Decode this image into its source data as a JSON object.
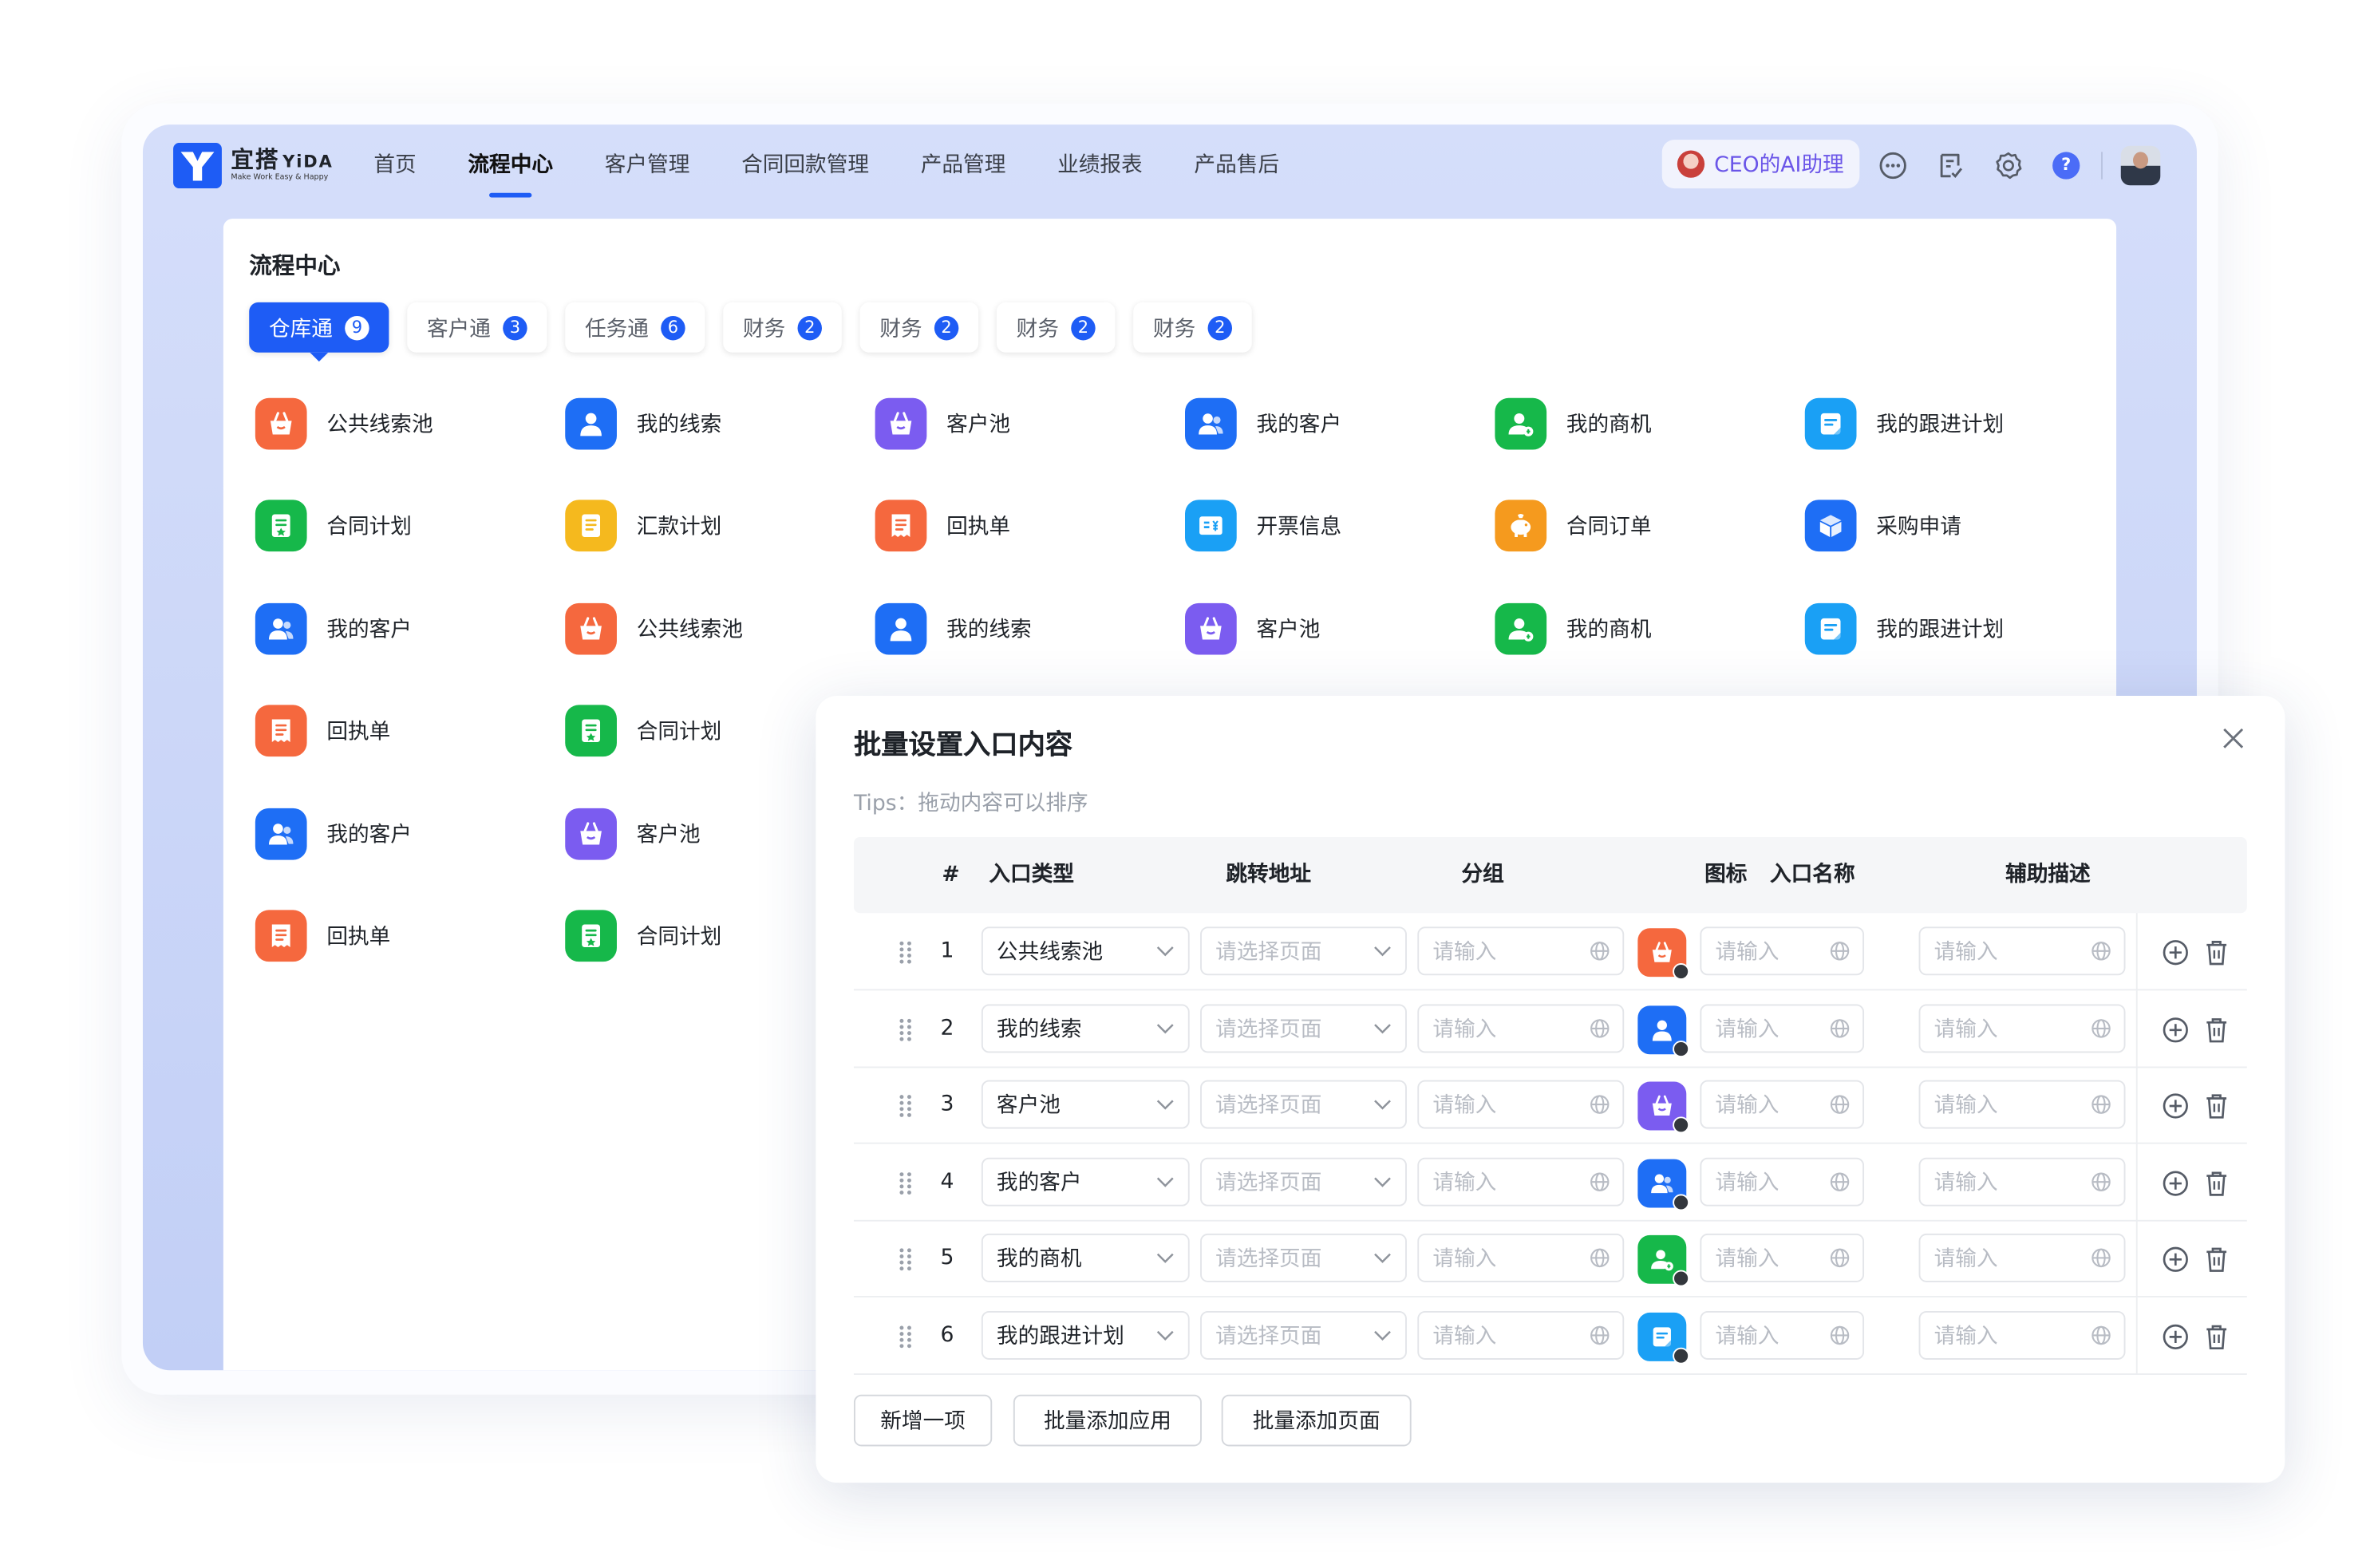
{
  "brand": {
    "name": "宜搭",
    "name_en": "YiDA",
    "slogan": "Make Work Easy & Happy",
    "color": "#1E5CF5"
  },
  "nav": {
    "items": [
      "首页",
      "流程中心",
      "客户管理",
      "合同回款管理",
      "产品管理",
      "业绩报表",
      "产品售后"
    ],
    "active": "流程中心"
  },
  "topbar": {
    "ai_assistant_label": "CEO的AI助理",
    "icons": [
      "more-circle-icon",
      "todo-list-icon",
      "settings-gear-icon",
      "help-icon",
      "user-avatar"
    ],
    "help_glyph": "?"
  },
  "page": {
    "title": "流程中心"
  },
  "tabs": [
    {
      "label": "仓库通",
      "count": "9",
      "active": true
    },
    {
      "label": "客户通",
      "count": "3"
    },
    {
      "label": "任务通",
      "count": "6"
    },
    {
      "label": "财务",
      "count": "2"
    },
    {
      "label": "财务",
      "count": "2"
    },
    {
      "label": "财务",
      "count": "2"
    },
    {
      "label": "财务",
      "count": "2"
    }
  ],
  "grid": {
    "rows": [
      [
        {
          "label": "公共线索池",
          "icon": "basket-icon",
          "color": "#F5683E"
        },
        {
          "label": "我的线索",
          "icon": "user-icon",
          "color": "#1E6EF5"
        },
        {
          "label": "客户池",
          "icon": "basket-icon",
          "color": "#7B5CF0"
        },
        {
          "label": "我的客户",
          "icon": "users-icon",
          "color": "#1E6EF5"
        },
        {
          "label": "我的商机",
          "icon": "user-coin-icon",
          "color": "#16B84A"
        },
        {
          "label": "我的跟进计划",
          "icon": "note-icon",
          "color": "#1AA0F5"
        }
      ],
      [
        {
          "label": "合同计划",
          "icon": "contract-icon",
          "color": "#16B84A"
        },
        {
          "label": "汇款计划",
          "icon": "document-icon",
          "color": "#F5B91E"
        },
        {
          "label": "回执单",
          "icon": "receipt-icon",
          "color": "#F5683E"
        },
        {
          "label": "开票信息",
          "icon": "invoice-icon",
          "color": "#1AA0F5"
        },
        {
          "label": "合同订单",
          "icon": "piggy-bank-icon",
          "color": "#F59A1E"
        },
        {
          "label": "采购申请",
          "icon": "box-icon",
          "color": "#1E6EF5"
        }
      ],
      [
        {
          "label": "我的客户",
          "icon": "users-icon",
          "color": "#1E6EF5"
        },
        {
          "label": "公共线索池",
          "icon": "basket-icon",
          "color": "#F5683E"
        },
        {
          "label": "我的线索",
          "icon": "user-icon",
          "color": "#1E6EF5"
        },
        {
          "label": "客户池",
          "icon": "basket-icon",
          "color": "#7B5CF0"
        },
        {
          "label": "我的商机",
          "icon": "user-coin-icon",
          "color": "#16B84A"
        },
        {
          "label": "我的跟进计划",
          "icon": "note-icon",
          "color": "#1AA0F5"
        }
      ],
      [
        {
          "label": "回执单",
          "icon": "receipt-icon",
          "color": "#F5683E"
        },
        {
          "label": "合同计划",
          "icon": "contract-icon",
          "color": "#16B84A"
        }
      ],
      [
        {
          "label": "我的客户",
          "icon": "users-icon",
          "color": "#1E6EF5"
        },
        {
          "label": "客户池",
          "icon": "basket-icon",
          "color": "#7B5CF0"
        }
      ],
      [
        {
          "label": "回执单",
          "icon": "receipt-icon",
          "color": "#F5683E"
        },
        {
          "label": "合同计划",
          "icon": "contract-icon",
          "color": "#16B84A"
        }
      ]
    ]
  },
  "dialog": {
    "title": "批量设置入口内容",
    "tips": "Tips：拖动内容可以排序",
    "columns": [
      "#",
      "入口类型",
      "跳转地址",
      "分组",
      "图标",
      "入口名称",
      "辅助描述"
    ],
    "rows": [
      {
        "index": "1",
        "type": "公共线索池",
        "icon": "basket-icon",
        "icon_color": "#F5683E"
      },
      {
        "index": "2",
        "type": "我的线索",
        "icon": "user-icon",
        "icon_color": "#1E6EF5"
      },
      {
        "index": "3",
        "type": "客户池",
        "icon": "basket-icon",
        "icon_color": "#7B5CF0"
      },
      {
        "index": "4",
        "type": "我的客户",
        "icon": "users-icon",
        "icon_color": "#1E6EF5"
      },
      {
        "index": "5",
        "type": "我的商机",
        "icon": "user-coin-icon",
        "icon_color": "#16B84A"
      },
      {
        "index": "6",
        "type": "我的跟进计划",
        "icon": "note-icon",
        "icon_color": "#1AA0F5"
      }
    ],
    "placeholders": {
      "url": "请选择页面",
      "group": "请输入",
      "name": "请输入",
      "desc": "请输入"
    },
    "buttons": {
      "add_one": "新增一项",
      "batch_add_app": "批量添加应用",
      "batch_add_page": "批量添加页面"
    }
  }
}
